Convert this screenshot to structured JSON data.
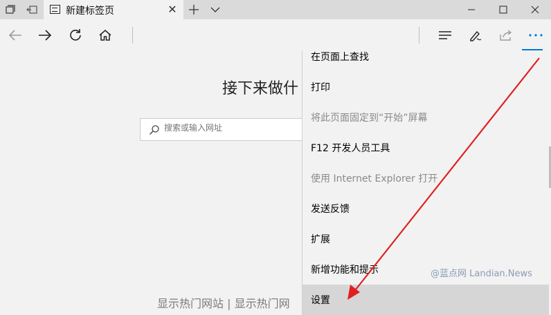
{
  "tab": {
    "title": "新建标签页"
  },
  "page": {
    "heading": "接下来做什",
    "search_placeholder": "搜索或输入网址",
    "footer": "显示热门网站 | 显示热门网"
  },
  "menu": {
    "items": [
      {
        "label": "在页面上查找",
        "disabled": false
      },
      {
        "label": "打印",
        "disabled": false
      },
      {
        "label": "将此页面固定到“开始”屏幕",
        "disabled": true
      },
      {
        "label": "F12 开发人员工具",
        "disabled": false
      },
      {
        "label": "使用 Internet Explorer 打开",
        "disabled": true
      },
      {
        "label": "发送反馈",
        "disabled": false
      },
      {
        "label": "扩展",
        "disabled": false
      },
      {
        "label": "新增功能和提示",
        "disabled": false
      },
      {
        "label": "设置",
        "disabled": false,
        "highlighted": true
      }
    ]
  },
  "watermark": "@蓝点网 Landian.News",
  "colors": {
    "accent": "#0078d7",
    "arrow": "#e02020"
  },
  "icons": [
    "tab-preview-icon",
    "tab-aside-icon",
    "new-tab-icon",
    "tab-list-chevron-icon",
    "minimize-icon",
    "maximize-icon",
    "close-icon",
    "back-icon",
    "forward-icon",
    "refresh-icon",
    "home-icon",
    "hub-icon",
    "web-note-icon",
    "share-icon",
    "more-icon",
    "search-icon"
  ]
}
